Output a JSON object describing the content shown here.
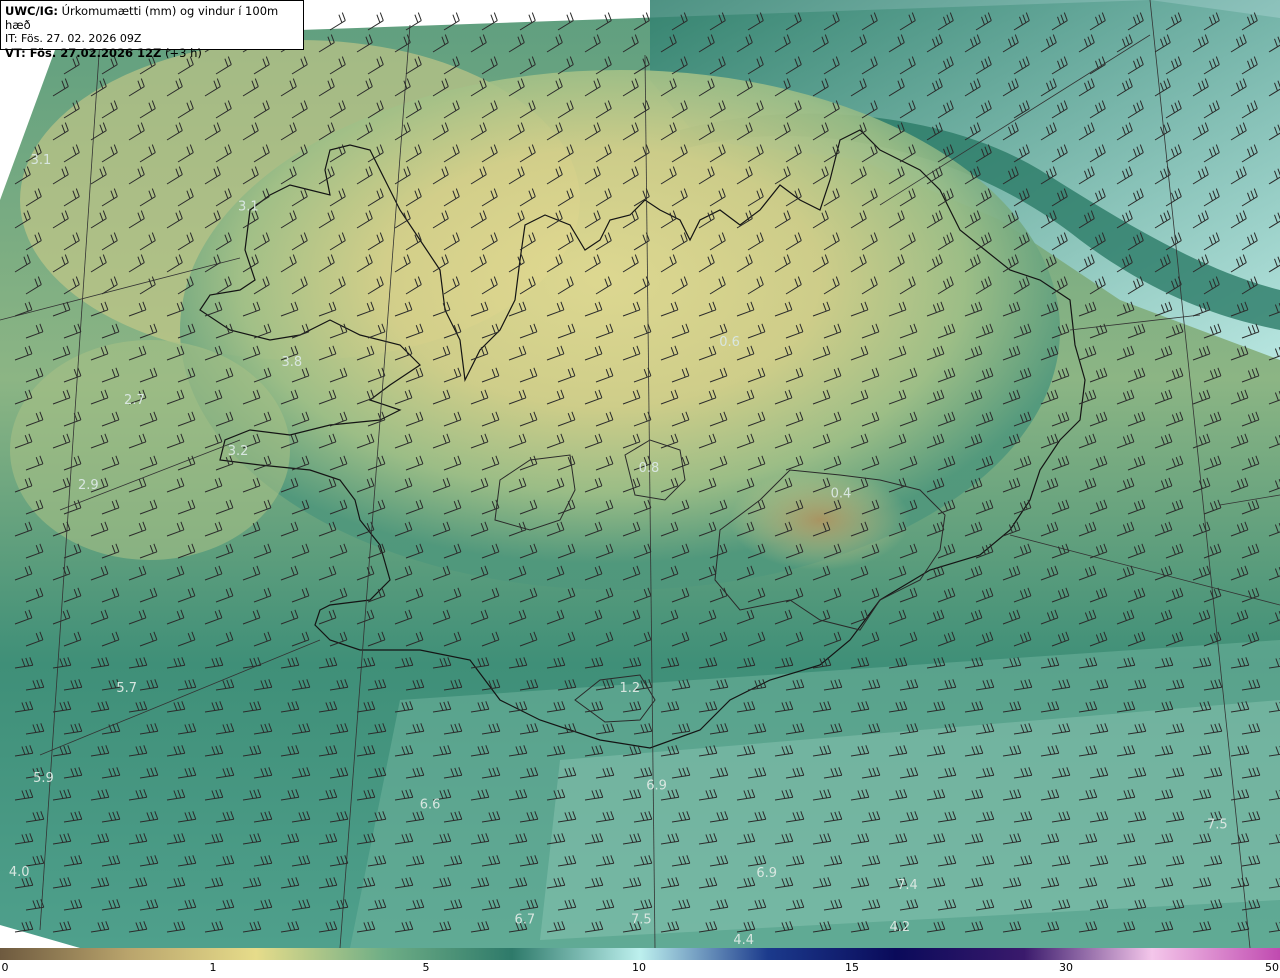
{
  "header": {
    "product": "UWC/IG:",
    "title": "Úrkomumætti (mm) og vindur í 100m hæð",
    "init_time": "IT: Fös. 27. 02. 2026 09Z",
    "valid_time_bold": "VT: Fös. 27.02.2026 12Z",
    "valid_time_offset": "(+3 h)"
  },
  "colors": {
    "low_sea": "#3f8f78",
    "mid": "#7fae82",
    "land_dry": "#d9d38f",
    "brown": "#a89462",
    "high": "#8fd6c9",
    "coast": "#1a1a1a"
  },
  "colorbar": {
    "ticks": [
      "0",
      "1",
      "5",
      "10",
      "15",
      "30",
      "50"
    ],
    "tick_values": [
      0,
      1,
      5,
      10,
      15,
      30,
      50
    ],
    "colors": [
      "#6e5a3f",
      "#b9a46c",
      "#e6dc8a",
      "#6fae86",
      "#2e7a6a",
      "#bdf0ee",
      "#1b3a8c",
      "#0a0a5a",
      "#3a1a6c",
      "#f4c6ea",
      "#c04ab0"
    ]
  },
  "map_labels": [
    {
      "text": "3.1",
      "x_pct": 3.2,
      "y_pct": 17.3
    },
    {
      "text": "3.1",
      "x_pct": 19.4,
      "y_pct": 22.2
    },
    {
      "text": "3.8",
      "x_pct": 22.8,
      "y_pct": 38.6
    },
    {
      "text": "2.7",
      "x_pct": 10.5,
      "y_pct": 42.6
    },
    {
      "text": "3.2",
      "x_pct": 18.6,
      "y_pct": 48.0
    },
    {
      "text": "2.9",
      "x_pct": 6.9,
      "y_pct": 51.6
    },
    {
      "text": "0.6",
      "x_pct": 57.0,
      "y_pct": 36.5
    },
    {
      "text": "0.8",
      "x_pct": 50.7,
      "y_pct": 49.8
    },
    {
      "text": "0.4",
      "x_pct": 65.7,
      "y_pct": 52.5
    },
    {
      "text": "5.7",
      "x_pct": 9.9,
      "y_pct": 73.0
    },
    {
      "text": "1.2",
      "x_pct": 49.2,
      "y_pct": 73.0
    },
    {
      "text": "5.9",
      "x_pct": 3.4,
      "y_pct": 82.5
    },
    {
      "text": "6.6",
      "x_pct": 33.6,
      "y_pct": 85.3
    },
    {
      "text": "6.9",
      "x_pct": 51.3,
      "y_pct": 83.3
    },
    {
      "text": "7.5",
      "x_pct": 95.1,
      "y_pct": 87.4
    },
    {
      "text": "4.0",
      "x_pct": 1.5,
      "y_pct": 92.4
    },
    {
      "text": "6.9",
      "x_pct": 59.9,
      "y_pct": 92.5
    },
    {
      "text": "7.4",
      "x_pct": 70.9,
      "y_pct": 93.8
    },
    {
      "text": "6.7",
      "x_pct": 41.0,
      "y_pct": 97.4
    },
    {
      "text": "7.5",
      "x_pct": 50.1,
      "y_pct": 97.4
    },
    {
      "text": "4.2",
      "x_pct": 70.3,
      "y_pct": 98.2
    },
    {
      "text": "4.4",
      "x_pct": 58.1,
      "y_pct": 99.6
    }
  ]
}
